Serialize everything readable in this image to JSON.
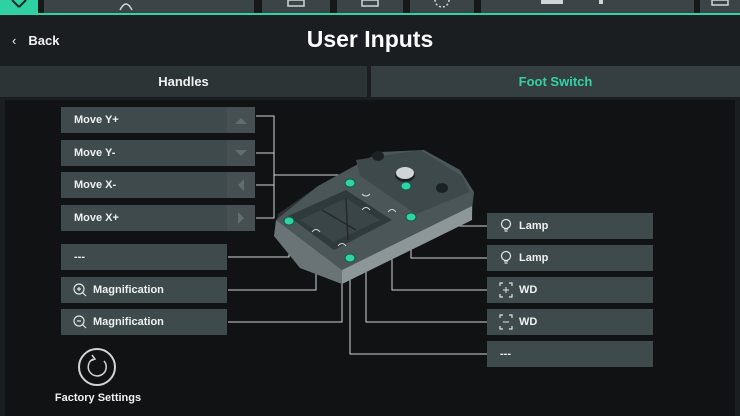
{
  "header": {
    "back_label": "Back",
    "title": "User Inputs"
  },
  "tabs": [
    {
      "label": "Handles",
      "active": false
    },
    {
      "label": "Foot Switch",
      "active": true
    }
  ],
  "left_buttons": [
    {
      "label": "Move Y+",
      "arrow": "up-arrow-icon"
    },
    {
      "label": "Move Y-",
      "arrow": "down-arrow-icon"
    },
    {
      "label": "Move X-",
      "arrow": "left-arrow-icon"
    },
    {
      "label": "Move X+",
      "arrow": "right-arrow-icon"
    },
    {
      "label": "---"
    },
    {
      "label": "Magnification",
      "icon": "zoom-in-icon"
    },
    {
      "label": "Magnification",
      "icon": "zoom-out-icon"
    }
  ],
  "right_buttons": [
    {
      "label": "Lamp",
      "icon": "lamp-icon"
    },
    {
      "label": "Lamp",
      "icon": "lamp-icon"
    },
    {
      "label": "WD",
      "icon": "wd-icon"
    },
    {
      "label": "WD",
      "icon": "wd-icon"
    },
    {
      "label": "---"
    }
  ],
  "factory": {
    "label": "Factory Settings",
    "icon": "reset-icon"
  },
  "colors": {
    "accent": "#31d3a6",
    "background": "#1b1e20",
    "panel": "#101213",
    "button": "#3f4a4c"
  }
}
